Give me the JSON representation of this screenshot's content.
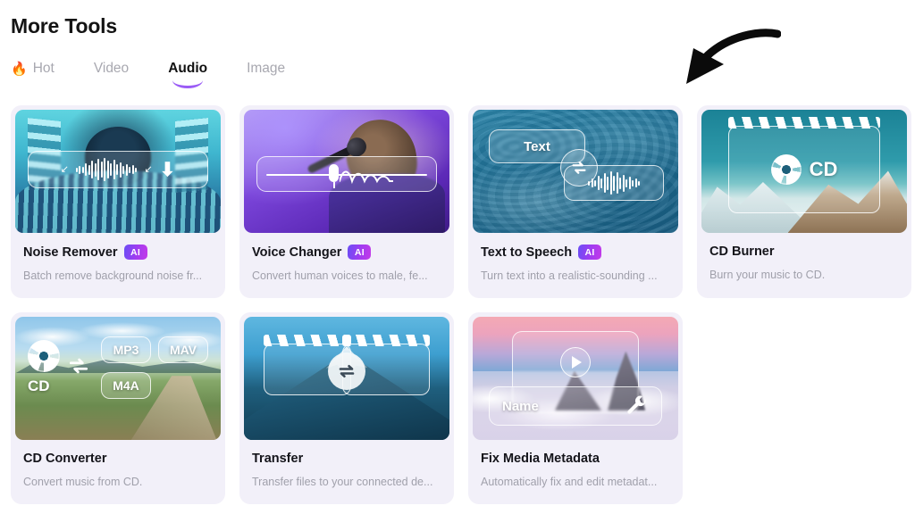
{
  "header": {
    "title": "More Tools"
  },
  "tabs": [
    {
      "label": "Hot",
      "icon": "flame-icon",
      "active": false
    },
    {
      "label": "Video",
      "icon": "",
      "active": false
    },
    {
      "label": "Audio",
      "icon": "",
      "active": true
    },
    {
      "label": "Image",
      "icon": "",
      "active": false
    }
  ],
  "annotation": {
    "type": "curved-arrow",
    "points_to": "Text to Speech",
    "color": "#0b0b0b"
  },
  "highlight": {
    "card": "Text to Speech",
    "color": "#fbd850"
  },
  "badges": {
    "ai_label": "AI",
    "ai_gradient_from": "#6a4df5",
    "ai_gradient_to": "#c43ae8"
  },
  "cards": [
    {
      "title": "Noise Remover",
      "ai": true,
      "description": "Batch remove background noise fr...",
      "thumb_art": "cyan-portrait-waveform",
      "highlighted": false
    },
    {
      "title": "Voice Changer",
      "ai": true,
      "description": "Convert human voices to male, fe...",
      "thumb_art": "purple-singer-microphone",
      "highlighted": false
    },
    {
      "title": "Text to Speech",
      "ai": true,
      "description": "Turn text into a realistic-sounding ...",
      "thumb_art": "blue-water-text-swap-waveform",
      "overlay_text": "Text",
      "highlighted": true
    },
    {
      "title": "CD Burner",
      "ai": false,
      "description": "Burn your music to CD.",
      "thumb_art": "snowy-mountain-clapper-cd",
      "overlay_text": "CD",
      "highlighted": false
    },
    {
      "title": "CD Converter",
      "ai": false,
      "description": "Convert music from CD.",
      "thumb_art": "green-valley-format-chips",
      "overlay_text": "CD",
      "chips": [
        "MP3",
        "MAV",
        "M4A"
      ],
      "highlighted": false
    },
    {
      "title": "Transfer",
      "ai": false,
      "description": "Transfer files to your connected de...",
      "thumb_art": "blue-mountain-two-clappers",
      "highlighted": false
    },
    {
      "title": "Fix Media Metadata",
      "ai": false,
      "description": "Automatically fix and edit metadat...",
      "thumb_art": "sunset-clouds-name-wrench",
      "overlay_text": "Name",
      "highlighted": false
    }
  ],
  "colors": {
    "card_background": "#f2f0f9",
    "page_background": "#ffffff",
    "title_text": "#14141a",
    "description_text": "#a0a0ab",
    "tab_inactive": "#a8a8b0",
    "tab_active_underline": "#9b5cf6"
  }
}
